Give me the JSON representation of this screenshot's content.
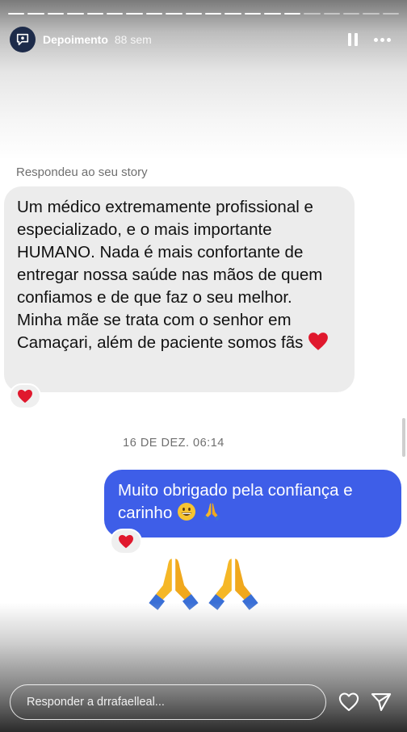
{
  "story": {
    "progress": {
      "total": 20,
      "done": 15
    },
    "header": {
      "account_name": "Depoimento",
      "time_ago": "88 sem"
    },
    "icons": {
      "avatar": "speech-bubble-icon",
      "pause": "pause-icon",
      "more": "more-icon",
      "heart": "heart-icon",
      "send": "send-icon"
    }
  },
  "chat": {
    "replied_label": "Respondeu ao seu story",
    "incoming_message": "Um médico extremamente profissional e especializado, e o mais importante HUMANO. Nada é mais confortante de entregar nossa saúde nas mãos de quem confiamos e de que faz o seu melhor. Minha mãe se trata com o senhor em Camaçari, além de paciente somos fãs",
    "incoming_reaction": "❤️",
    "date_separator": "16 DE DEZ. 06:14",
    "outgoing_message": "Muito obrigado pela confiança e carinho",
    "outgoing_emojis": [
      "grinning-face",
      "folded-hands"
    ],
    "outgoing_reaction": "❤️",
    "big_emojis": [
      "folded-hands",
      "folded-hands"
    ]
  },
  "footer": {
    "reply_placeholder": "Responder a drrafaelleal..."
  },
  "colors": {
    "outgoing_bubble": "#3e5ee8",
    "incoming_bubble": "#ececec",
    "heart": "#e0182d"
  }
}
